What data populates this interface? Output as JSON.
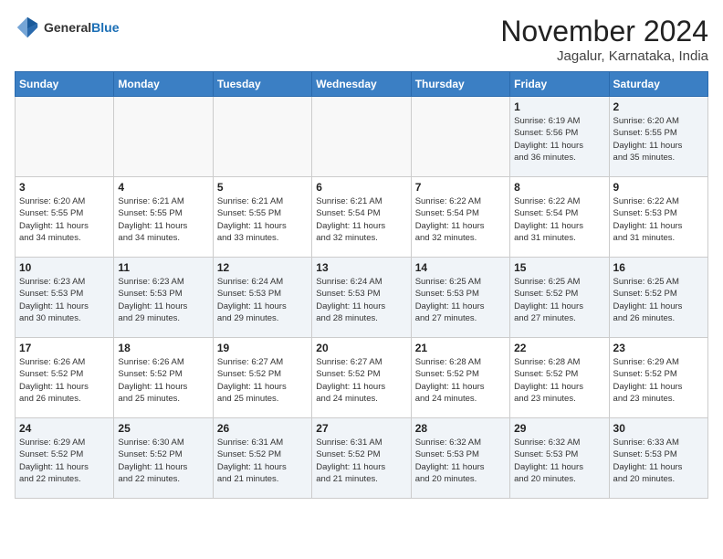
{
  "logo": {
    "general": "General",
    "blue": "Blue"
  },
  "title": "November 2024",
  "location": "Jagalur, Karnataka, India",
  "weekdays": [
    "Sunday",
    "Monday",
    "Tuesday",
    "Wednesday",
    "Thursday",
    "Friday",
    "Saturday"
  ],
  "weeks": [
    [
      {
        "day": "",
        "info": ""
      },
      {
        "day": "",
        "info": ""
      },
      {
        "day": "",
        "info": ""
      },
      {
        "day": "",
        "info": ""
      },
      {
        "day": "",
        "info": ""
      },
      {
        "day": "1",
        "info": "Sunrise: 6:19 AM\nSunset: 5:56 PM\nDaylight: 11 hours\nand 36 minutes."
      },
      {
        "day": "2",
        "info": "Sunrise: 6:20 AM\nSunset: 5:55 PM\nDaylight: 11 hours\nand 35 minutes."
      }
    ],
    [
      {
        "day": "3",
        "info": "Sunrise: 6:20 AM\nSunset: 5:55 PM\nDaylight: 11 hours\nand 34 minutes."
      },
      {
        "day": "4",
        "info": "Sunrise: 6:21 AM\nSunset: 5:55 PM\nDaylight: 11 hours\nand 34 minutes."
      },
      {
        "day": "5",
        "info": "Sunrise: 6:21 AM\nSunset: 5:55 PM\nDaylight: 11 hours\nand 33 minutes."
      },
      {
        "day": "6",
        "info": "Sunrise: 6:21 AM\nSunset: 5:54 PM\nDaylight: 11 hours\nand 32 minutes."
      },
      {
        "day": "7",
        "info": "Sunrise: 6:22 AM\nSunset: 5:54 PM\nDaylight: 11 hours\nand 32 minutes."
      },
      {
        "day": "8",
        "info": "Sunrise: 6:22 AM\nSunset: 5:54 PM\nDaylight: 11 hours\nand 31 minutes."
      },
      {
        "day": "9",
        "info": "Sunrise: 6:22 AM\nSunset: 5:53 PM\nDaylight: 11 hours\nand 31 minutes."
      }
    ],
    [
      {
        "day": "10",
        "info": "Sunrise: 6:23 AM\nSunset: 5:53 PM\nDaylight: 11 hours\nand 30 minutes."
      },
      {
        "day": "11",
        "info": "Sunrise: 6:23 AM\nSunset: 5:53 PM\nDaylight: 11 hours\nand 29 minutes."
      },
      {
        "day": "12",
        "info": "Sunrise: 6:24 AM\nSunset: 5:53 PM\nDaylight: 11 hours\nand 29 minutes."
      },
      {
        "day": "13",
        "info": "Sunrise: 6:24 AM\nSunset: 5:53 PM\nDaylight: 11 hours\nand 28 minutes."
      },
      {
        "day": "14",
        "info": "Sunrise: 6:25 AM\nSunset: 5:53 PM\nDaylight: 11 hours\nand 27 minutes."
      },
      {
        "day": "15",
        "info": "Sunrise: 6:25 AM\nSunset: 5:52 PM\nDaylight: 11 hours\nand 27 minutes."
      },
      {
        "day": "16",
        "info": "Sunrise: 6:25 AM\nSunset: 5:52 PM\nDaylight: 11 hours\nand 26 minutes."
      }
    ],
    [
      {
        "day": "17",
        "info": "Sunrise: 6:26 AM\nSunset: 5:52 PM\nDaylight: 11 hours\nand 26 minutes."
      },
      {
        "day": "18",
        "info": "Sunrise: 6:26 AM\nSunset: 5:52 PM\nDaylight: 11 hours\nand 25 minutes."
      },
      {
        "day": "19",
        "info": "Sunrise: 6:27 AM\nSunset: 5:52 PM\nDaylight: 11 hours\nand 25 minutes."
      },
      {
        "day": "20",
        "info": "Sunrise: 6:27 AM\nSunset: 5:52 PM\nDaylight: 11 hours\nand 24 minutes."
      },
      {
        "day": "21",
        "info": "Sunrise: 6:28 AM\nSunset: 5:52 PM\nDaylight: 11 hours\nand 24 minutes."
      },
      {
        "day": "22",
        "info": "Sunrise: 6:28 AM\nSunset: 5:52 PM\nDaylight: 11 hours\nand 23 minutes."
      },
      {
        "day": "23",
        "info": "Sunrise: 6:29 AM\nSunset: 5:52 PM\nDaylight: 11 hours\nand 23 minutes."
      }
    ],
    [
      {
        "day": "24",
        "info": "Sunrise: 6:29 AM\nSunset: 5:52 PM\nDaylight: 11 hours\nand 22 minutes."
      },
      {
        "day": "25",
        "info": "Sunrise: 6:30 AM\nSunset: 5:52 PM\nDaylight: 11 hours\nand 22 minutes."
      },
      {
        "day": "26",
        "info": "Sunrise: 6:31 AM\nSunset: 5:52 PM\nDaylight: 11 hours\nand 21 minutes."
      },
      {
        "day": "27",
        "info": "Sunrise: 6:31 AM\nSunset: 5:52 PM\nDaylight: 11 hours\nand 21 minutes."
      },
      {
        "day": "28",
        "info": "Sunrise: 6:32 AM\nSunset: 5:53 PM\nDaylight: 11 hours\nand 20 minutes."
      },
      {
        "day": "29",
        "info": "Sunrise: 6:32 AM\nSunset: 5:53 PM\nDaylight: 11 hours\nand 20 minutes."
      },
      {
        "day": "30",
        "info": "Sunrise: 6:33 AM\nSunset: 5:53 PM\nDaylight: 11 hours\nand 20 minutes."
      }
    ]
  ]
}
